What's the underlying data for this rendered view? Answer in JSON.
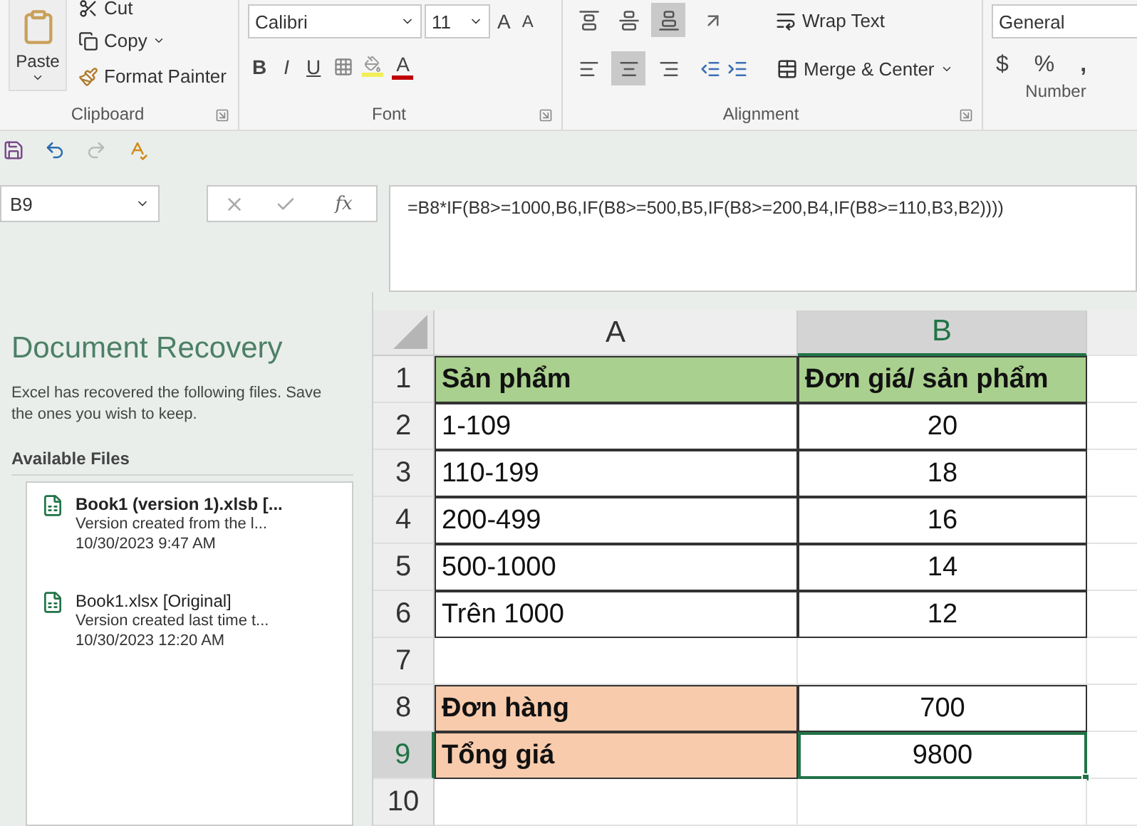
{
  "ribbon": {
    "clipboard": {
      "paste": "Paste",
      "cut": "Cut",
      "copy": "Copy",
      "format_painter": "Format Painter",
      "label": "Clipboard"
    },
    "font": {
      "name": "Calibri",
      "size": "11",
      "grow": "A",
      "shrink": "A",
      "bold": "B",
      "italic": "I",
      "underline": "U",
      "font_color": "A",
      "label": "Font"
    },
    "alignment": {
      "vertical": [
        {
          "selected": false
        },
        {
          "selected": false
        },
        {
          "selected": true
        }
      ],
      "horizontal": [
        {
          "selected": false
        },
        {
          "selected": true
        },
        {
          "selected": false
        }
      ],
      "wrap_text": "Wrap Text",
      "merge_center": "Merge & Center",
      "label": "Alignment"
    },
    "number": {
      "format": "General",
      "currency": "$",
      "percent": "%",
      "comma": ",",
      "label": "Number"
    }
  },
  "formula_bar": {
    "name_box": "B9",
    "fx": "fx",
    "formula": "=B8*IF(B8>=1000,B6,IF(B8>=500,B5,IF(B8>=200,B4,IF(B8>=110,B3,B2))))"
  },
  "recovery": {
    "title": "Document Recovery",
    "description": "Excel has recovered the following files. Save the ones you wish to keep.",
    "section": "Available Files",
    "files": [
      {
        "name": "Book1 (version 1).xlsb  [...",
        "latest": true,
        "description": "Version created from the l...",
        "time": "10/30/2023 9:47 AM"
      },
      {
        "name": "Book1.xlsx  [Original]",
        "latest": false,
        "description": "Version created last time t...",
        "time": "10/30/2023 12:20 AM"
      }
    ]
  },
  "sheet": {
    "columns": [
      {
        "label": "A",
        "selected": false
      },
      {
        "label": "B",
        "selected": true
      }
    ],
    "rows": [
      {
        "header": "1",
        "selected": false,
        "cells": [
          {
            "text": "Sản phẩm",
            "bold": true,
            "color": "#a9d08e",
            "selected": false
          },
          {
            "text": "Đơn giá/ sản phẩm",
            "bold": true,
            "color": "#a9d08e",
            "selected": false
          }
        ]
      },
      {
        "header": "2",
        "selected": false,
        "cells": [
          {
            "text": "1-109",
            "bold": false,
            "selected": false
          },
          {
            "text": "20",
            "bold": false,
            "selected": false
          }
        ]
      },
      {
        "header": "3",
        "selected": false,
        "cells": [
          {
            "text": "110-199",
            "bold": false,
            "selected": false
          },
          {
            "text": "18",
            "bold": false,
            "selected": false
          }
        ]
      },
      {
        "header": "4",
        "selected": false,
        "cells": [
          {
            "text": "200-499",
            "bold": false,
            "selected": false
          },
          {
            "text": "16",
            "bold": false,
            "selected": false
          }
        ]
      },
      {
        "header": "5",
        "selected": false,
        "cells": [
          {
            "text": "500-1000",
            "bold": false,
            "selected": false
          },
          {
            "text": "14",
            "bold": false,
            "selected": false
          }
        ]
      },
      {
        "header": "6",
        "selected": false,
        "cells": [
          {
            "text": "Trên 1000",
            "bold": false,
            "selected": false
          },
          {
            "text": "12",
            "bold": false,
            "selected": false
          }
        ]
      },
      {
        "header": "7",
        "selected": false
      },
      {
        "header": "8",
        "selected": false,
        "cells": [
          {
            "text": "Đơn hàng",
            "bold": true,
            "color": "#f8cbad",
            "selected": false
          },
          {
            "text": "700",
            "bold": false,
            "selected": false
          }
        ]
      },
      {
        "header": "9",
        "selected": true,
        "cells": [
          {
            "text": "Tổng giá",
            "bold": true,
            "color": "#f8cbad",
            "selected": false
          },
          {
            "text": "9800",
            "bold": false,
            "selected": true
          }
        ]
      },
      {
        "header": "10",
        "selected": false
      }
    ]
  }
}
